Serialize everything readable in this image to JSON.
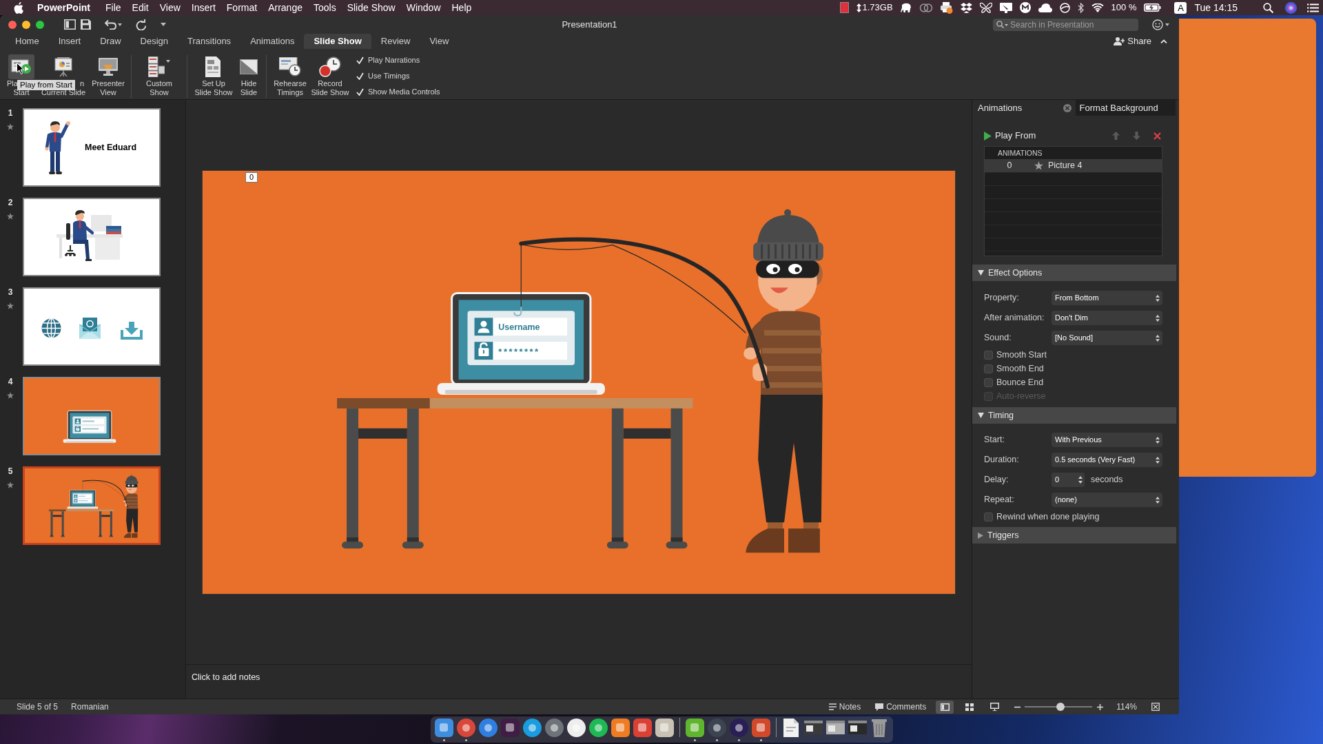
{
  "menu_bar": {
    "app_name": "PowerPoint",
    "menus": [
      "File",
      "Edit",
      "View",
      "Insert",
      "Format",
      "Arrange",
      "Tools",
      "Slide Show",
      "Window",
      "Help"
    ],
    "memory": "1.73GB",
    "battery": "100 %",
    "input_source": "A",
    "clock": "Tue 14:15"
  },
  "window": {
    "title": "Presentation1",
    "search": {
      "placeholder": "Search in Presentation"
    },
    "share": "Share"
  },
  "tabs": [
    {
      "label": "Home",
      "selected": false
    },
    {
      "label": "Insert",
      "selected": false
    },
    {
      "label": "Draw",
      "selected": false
    },
    {
      "label": "Design",
      "selected": false
    },
    {
      "label": "Transitions",
      "selected": false
    },
    {
      "label": "Animations",
      "selected": false
    },
    {
      "label": "Slide Show",
      "selected": true
    },
    {
      "label": "Review",
      "selected": false
    },
    {
      "label": "View",
      "selected": false
    }
  ],
  "ribbon": {
    "groups": [
      [
        {
          "kind": "play-start",
          "lines": [
            "Pla",
            "Start"
          ],
          "highlighted": true
        },
        {
          "kind": "play-current",
          "lines": [
            "n",
            "Current Slide"
          ],
          "highlighted": false
        },
        {
          "kind": "presenter-view",
          "lines": [
            "Presenter",
            "View"
          ],
          "highlighted": false
        }
      ],
      [
        {
          "kind": "custom-show",
          "lines": [
            "Custom",
            "Show"
          ],
          "highlighted": false
        }
      ],
      [
        {
          "kind": "setup",
          "lines": [
            "Set Up",
            "Slide Show"
          ],
          "highlighted": false
        },
        {
          "kind": "hide-slide",
          "lines": [
            "Hide",
            "Slide"
          ],
          "highlighted": false
        }
      ],
      [
        {
          "kind": "rehearse",
          "lines": [
            "Rehearse",
            "Timings"
          ],
          "highlighted": false
        },
        {
          "kind": "record",
          "lines": [
            "Record",
            "Slide Show"
          ],
          "highlighted": false
        }
      ]
    ],
    "options": [
      {
        "label": "Play Narrations",
        "checked": true
      },
      {
        "label": "Use Timings",
        "checked": true
      },
      {
        "label": "Show Media Controls",
        "checked": true
      }
    ],
    "tooltip": "Play from Start"
  },
  "slides": [
    {
      "number": "1",
      "kind": "title",
      "title": "Meet Eduard",
      "selected": false
    },
    {
      "number": "2",
      "kind": "desk",
      "selected": false
    },
    {
      "number": "3",
      "kind": "icons",
      "selected": false
    },
    {
      "number": "4",
      "kind": "laptop",
      "selected": false
    },
    {
      "number": "5",
      "kind": "phishing",
      "selected": true
    }
  ],
  "slide": {
    "animation_tag": "0",
    "username": "Username",
    "password": "********"
  },
  "notes": {
    "placeholder": "Click to add notes"
  },
  "pane": {
    "tabs": [
      {
        "label": "Animations",
        "selected": true,
        "closable": true
      },
      {
        "label": "Format Background",
        "selected": false,
        "closable": false
      }
    ],
    "play_from": "Play From",
    "list_header": "ANIMATIONS",
    "animations": [
      {
        "order": "0",
        "name": "Picture 4",
        "selected": true
      }
    ],
    "sections": [
      {
        "title": "Effect Options",
        "expanded": true,
        "fields": [
          {
            "kind": "select",
            "label": "Property:",
            "value": "From Bottom"
          },
          {
            "kind": "select",
            "label": "After animation:",
            "value": "Don't Dim"
          },
          {
            "kind": "select",
            "label": "Sound:",
            "value": "[No Sound]"
          },
          {
            "kind": "checkbox",
            "label": "Smooth Start",
            "checked": false,
            "disabled": false
          },
          {
            "kind": "checkbox",
            "label": "Smooth End",
            "checked": false,
            "disabled": false
          },
          {
            "kind": "checkbox",
            "label": "Bounce End",
            "checked": false,
            "disabled": false
          },
          {
            "kind": "checkbox",
            "label": "Auto-reverse",
            "checked": false,
            "disabled": true
          }
        ]
      },
      {
        "title": "Timing",
        "expanded": true,
        "fields": [
          {
            "kind": "select",
            "label": "Start:",
            "value": "With Previous"
          },
          {
            "kind": "select",
            "label": "Duration:",
            "value": "0.5 seconds (Very Fast)"
          },
          {
            "kind": "stepper",
            "label": "Delay:",
            "value": "0",
            "unit": "seconds"
          },
          {
            "kind": "select",
            "label": "Repeat:",
            "value": "(none)"
          },
          {
            "kind": "checkbox",
            "label": "Rewind when done playing",
            "checked": false,
            "disabled": false
          }
        ]
      },
      {
        "title": "Triggers",
        "expanded": false
      }
    ]
  },
  "status_bar": {
    "slide_info": "Slide 5 of 5",
    "language": "Romanian",
    "notes": "Notes",
    "comments": "Comments",
    "views": [
      {
        "kind": "normal",
        "selected": true
      },
      {
        "kind": "sorter",
        "selected": false
      },
      {
        "kind": "reading",
        "selected": false
      }
    ],
    "zoom": {
      "level": 0.53,
      "reading": "114%"
    }
  },
  "dock": {
    "groups": [
      [
        {
          "kind": "square",
          "color": "#3d8de0",
          "running": true
        },
        {
          "kind": "round",
          "color": "#d9473a",
          "running": true
        },
        {
          "kind": "round",
          "color": "#2f7fe0",
          "running": false
        },
        {
          "kind": "square",
          "color": "#3f1d44",
          "running": false
        },
        {
          "kind": "round",
          "color": "#1a9ce0",
          "running": false
        },
        {
          "kind": "round",
          "color": "#6e737a",
          "running": false
        },
        {
          "kind": "round",
          "color": "#eeeeee",
          "running": false
        },
        {
          "kind": "round",
          "color": "#1db954",
          "running": false
        },
        {
          "kind": "square",
          "color": "#ef7b22",
          "running": false
        },
        {
          "kind": "square",
          "color": "#db4035",
          "running": false
        },
        {
          "kind": "square",
          "color": "#c9c2b4",
          "running": false
        }
      ],
      [
        {
          "kind": "square",
          "color": "#5fb52e",
          "running": true
        },
        {
          "kind": "round",
          "color": "#3c4452",
          "running": true
        },
        {
          "kind": "round",
          "color": "#2a1f55",
          "running": true
        },
        {
          "kind": "square",
          "color": "#d2492a",
          "running": true
        }
      ],
      [
        {
          "kind": "doc",
          "color": "#f2f2f2",
          "running": false
        },
        {
          "kind": "preview",
          "color": "#3a3a3a",
          "running": false
        },
        {
          "kind": "preview",
          "color": "#b0b0b0",
          "running": false
        },
        {
          "kind": "preview",
          "color": "#2a2a2a",
          "running": false
        },
        {
          "kind": "trash",
          "color": "#9a9a9a",
          "running": false
        }
      ]
    ]
  }
}
